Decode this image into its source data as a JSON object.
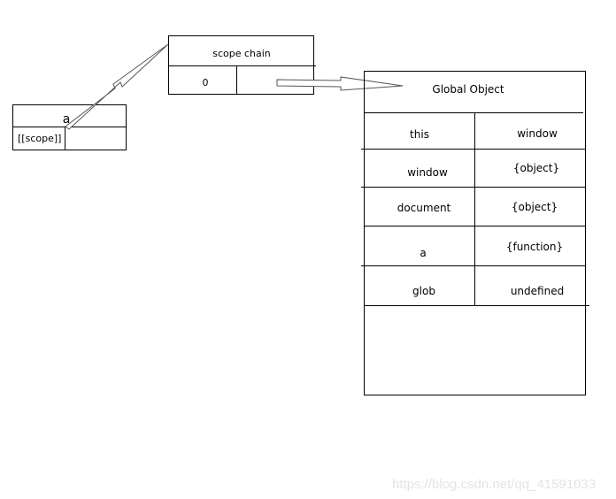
{
  "function_box": {
    "name": "a",
    "scope_label": "[[scope]]"
  },
  "scope_chain": {
    "title": "scope chain",
    "index": "0"
  },
  "global_object": {
    "title": "Global Object",
    "rows": [
      {
        "key": "this",
        "value": "window"
      },
      {
        "key": "window",
        "value": "{object}"
      },
      {
        "key": "document",
        "value": "{object}"
      },
      {
        "key": "a",
        "value": "{function}"
      },
      {
        "key": "glob",
        "value": "undefined"
      }
    ]
  },
  "watermark": "https://blog.csdn.net/qq_41591033"
}
